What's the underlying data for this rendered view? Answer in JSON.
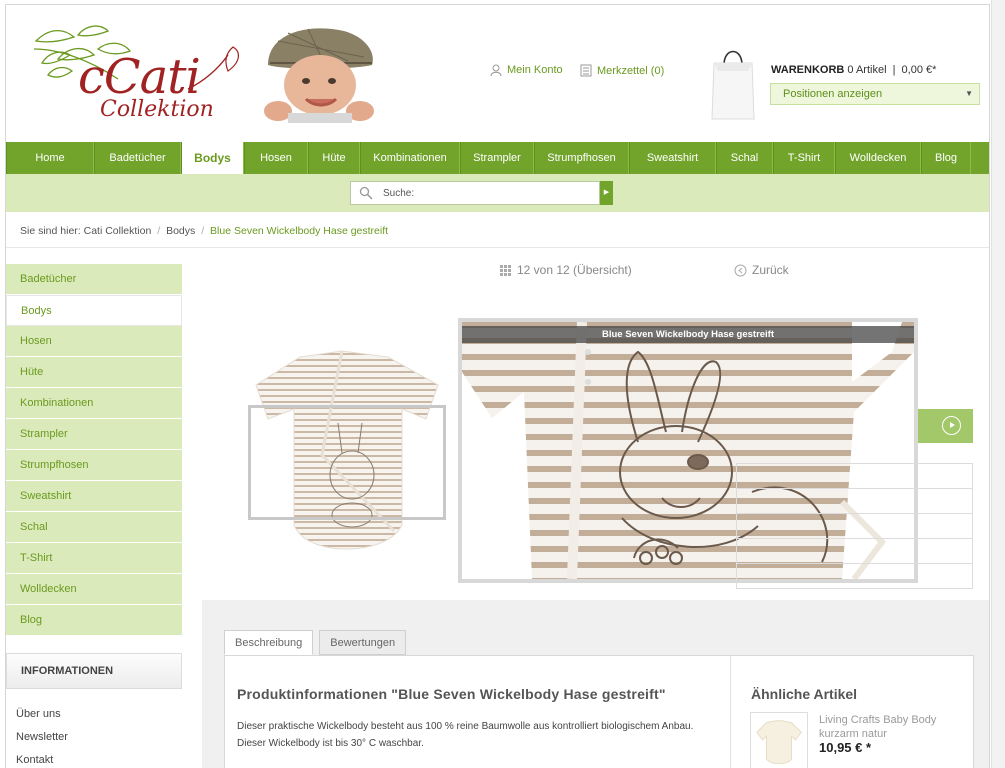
{
  "header": {
    "logo_word_1": "cCati",
    "logo_word_2": "Collektion",
    "account_label": "Mein Konto",
    "wishlist_label": "Merkzettel (0)",
    "cart_title": "WARENKORB",
    "cart_count": "0 Artikel",
    "cart_sep": "|",
    "cart_total": "0,00 €*",
    "cart_select": "Positionen anzeigen"
  },
  "nav": {
    "items": [
      {
        "label": "Home"
      },
      {
        "label": "Badetücher"
      },
      {
        "label": "Bodys"
      },
      {
        "label": "Hosen"
      },
      {
        "label": "Hüte"
      },
      {
        "label": "Kombinationen"
      },
      {
        "label": "Strampler"
      },
      {
        "label": "Strumpfhosen"
      },
      {
        "label": "Sweatshirt"
      },
      {
        "label": "Schal"
      },
      {
        "label": "T-Shirt"
      },
      {
        "label": "Wolldecken"
      },
      {
        "label": "Blog"
      }
    ],
    "active_index": 2
  },
  "search": {
    "placeholder": "Suche:"
  },
  "breadcrumb": {
    "prefix": "Sie sind hier:",
    "items": [
      "Cati Collektion",
      "Bodys"
    ],
    "current": "Blue Seven Wickelbody Hase gestreift",
    "separator": "/"
  },
  "sidebar": {
    "items": [
      {
        "label": "Badetücher"
      },
      {
        "label": "Bodys"
      },
      {
        "label": "Hosen"
      },
      {
        "label": "Hüte"
      },
      {
        "label": "Kombinationen"
      },
      {
        "label": "Strampler"
      },
      {
        "label": "Strumpfhosen"
      },
      {
        "label": "Sweatshirt"
      },
      {
        "label": "Schal"
      },
      {
        "label": "T-Shirt"
      },
      {
        "label": "Wolldecken"
      },
      {
        "label": "Blog"
      }
    ],
    "active_index": 1,
    "info_title": "INFORMATIONEN",
    "info_links": [
      "Über uns",
      "Newsletter",
      "Kontakt"
    ]
  },
  "product": {
    "position_text": "12 von 12 (Übersicht)",
    "back_label": "Zurück",
    "zoom_caption": "Blue Seven Wickelbody Hase gestreift"
  },
  "details": {
    "tabs": [
      "Beschreibung",
      "Bewertungen"
    ],
    "active_tab": 0,
    "title": "Produktinformationen \"Blue Seven Wickelbody Hase gestreift\"",
    "description": "Dieser praktische Wickelbody besteht aus 100 % reine Baumwolle aus kontrolliert biologischem Anbau. Dieser Wickelbody ist bis 30° C waschbar.",
    "similar_title": "Ähnliche Artikel",
    "similar_item_name": "Living Crafts Baby Body kurzarm natur",
    "similar_item_price": "10,95 € *"
  },
  "colors": {
    "brand_green": "#72a42c",
    "light_green": "#dbeabb",
    "logo_red": "#a12222"
  }
}
